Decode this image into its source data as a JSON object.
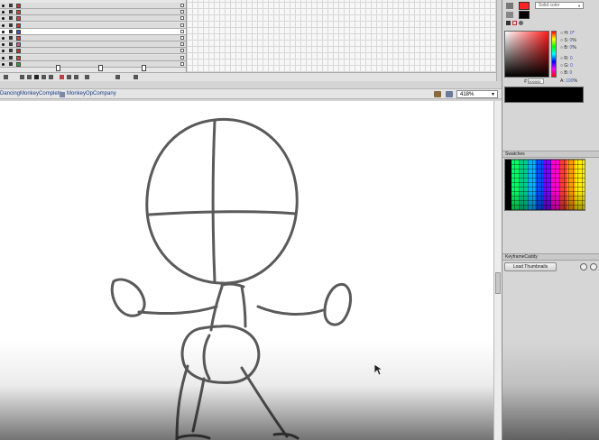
{
  "timeline": {
    "layers": [
      {
        "color": "#c83232"
      },
      {
        "color": "#e23a3a"
      },
      {
        "color": "#c04a4a"
      },
      {
        "color": "#d83030"
      },
      {
        "color": "#3a55c8"
      },
      {
        "color": "#d04040"
      },
      {
        "color": "#e05090"
      },
      {
        "color": "#c03030"
      },
      {
        "color": "#d84040"
      },
      {
        "color": "#30a040"
      }
    ]
  },
  "stage": {
    "breadcrumb_1": "DancingMonkeyComplete",
    "breadcrumb_2": "MonkeyOpCompany",
    "zoom": "418%"
  },
  "color_panel": {
    "fill_type": "Solid color",
    "stroke_color": "#000000",
    "fill_color": "#ff2222",
    "h_label": "H:",
    "h_value": "0",
    "h_unit": "°",
    "s_label": "S:",
    "s_value": "0",
    "s_unit": "%",
    "b_label": "B:",
    "b_value": "0",
    "b_unit": "%",
    "r_label": "R:",
    "r_value": "0",
    "g_label": "G:",
    "g_value": "0",
    "b2_label": "B:",
    "b2_value": "0",
    "a_label": "A:",
    "a_value": "100",
    "a_unit": "%",
    "hex_label": "#",
    "hex_value": "000000"
  },
  "swatches_panel": {
    "title": "Swatches"
  },
  "keyframe_panel": {
    "title": "KeyframeCaddy",
    "load_button": "Load Thumbnails"
  },
  "icons": [
    "eye-icon",
    "lock-icon",
    "outline-icon",
    "play-icon",
    "edit-scene-icon",
    "edit-symbol-icon",
    "zoom-in-icon",
    "zoom-out-icon",
    "mouse-cursor-icon"
  ]
}
